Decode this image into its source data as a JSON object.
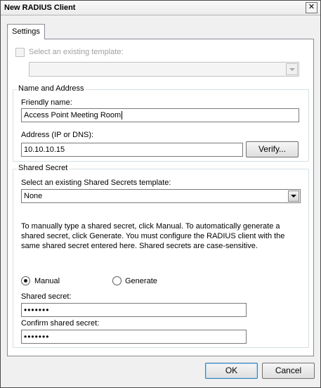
{
  "window": {
    "title": "New RADIUS Client",
    "close_glyph": "✕"
  },
  "tabs": [
    {
      "label": "Settings",
      "selected": true
    }
  ],
  "template": {
    "checkbox_label": "Select an existing template:",
    "checked": false,
    "enabled": false,
    "selected_value": ""
  },
  "name_address": {
    "group_label": "Name and Address",
    "friendly_name_label": "Friendly name:",
    "friendly_name_value": "Access Point Meeting Room",
    "address_label": "Address (IP or DNS):",
    "address_value": "10.10.10.15",
    "verify_button": "Verify..."
  },
  "shared_secret": {
    "group_label": "Shared Secret",
    "template_label": "Select an existing Shared Secrets template:",
    "template_value": "None",
    "description": "To manually type a shared secret, click Manual. To automatically generate a shared secret, click Generate. You must configure the RADIUS client with the same shared secret entered here. Shared secrets are case-sensitive.",
    "manual_label": "Manual",
    "generate_label": "Generate",
    "selected_mode": "manual",
    "secret_label": "Shared secret:",
    "secret_value": "•••••••",
    "confirm_label": "Confirm shared secret:",
    "confirm_value": "•••••••"
  },
  "footer": {
    "ok_button": "OK",
    "cancel_button": "Cancel"
  }
}
